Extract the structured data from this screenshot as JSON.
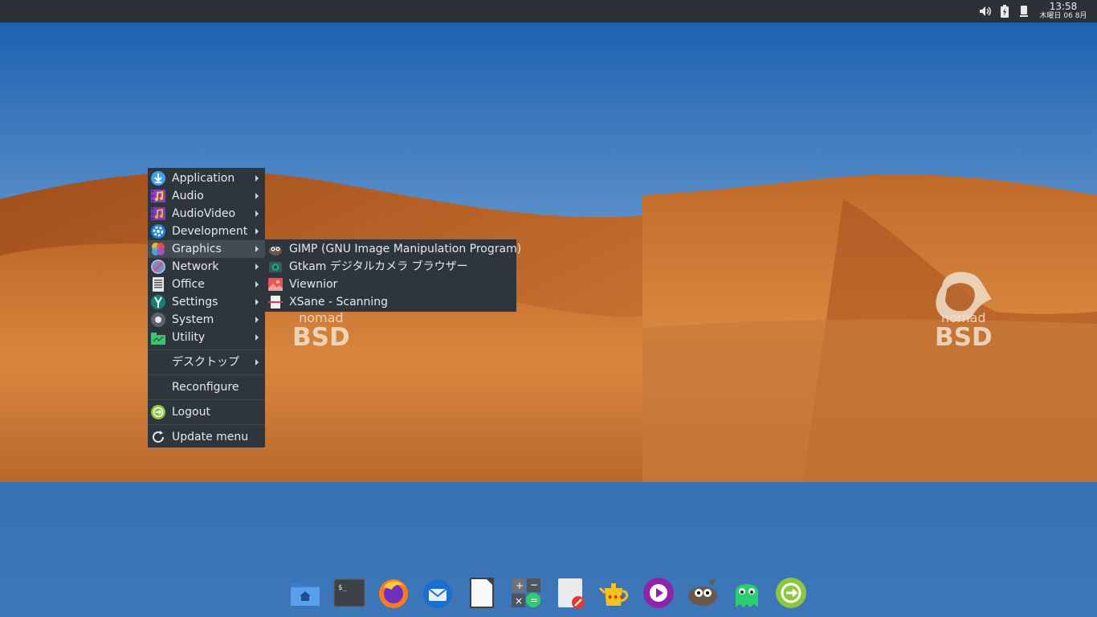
{
  "panel": {
    "clock_time": "13:58",
    "clock_date": "木曜日 06 8月",
    "tray_icons": [
      "volume-icon",
      "battery-icon",
      "removable-drive-icon"
    ]
  },
  "wallpaper": {
    "logo_line1": "nomad",
    "logo_line2": "BSD"
  },
  "menu": {
    "items": [
      {
        "label": "Application",
        "icon": "download-icon",
        "submenu": true
      },
      {
        "label": "Audio",
        "icon": "audio-icon",
        "submenu": true
      },
      {
        "label": "AudioVideo",
        "icon": "audiovideo-icon",
        "submenu": true
      },
      {
        "label": "Development",
        "icon": "gear-icon",
        "submenu": true
      },
      {
        "label": "Graphics",
        "icon": "graphics-icon",
        "submenu": true
      },
      {
        "label": "Network",
        "icon": "globe-icon",
        "submenu": true
      },
      {
        "label": "Office",
        "icon": "document-icon",
        "submenu": true
      },
      {
        "label": "Settings",
        "icon": "settings-icon",
        "submenu": true
      },
      {
        "label": "System",
        "icon": "system-icon",
        "submenu": true
      },
      {
        "label": "Utility",
        "icon": "utility-icon",
        "submenu": true
      }
    ],
    "desktop_label": "デスクトップ",
    "reconfigure_label": "Reconfigure",
    "logout_label": "Logout",
    "update_label": "Update menu"
  },
  "graphics_submenu": {
    "items": [
      {
        "label": "GIMP (GNU Image Manipulation Program)",
        "icon": "gimp-icon"
      },
      {
        "label": "Gtkam デジタルカメラ ブラウザー",
        "icon": "camera-icon"
      },
      {
        "label": "Viewnior",
        "icon": "image-viewer-icon"
      },
      {
        "label": "XSane - Scanning",
        "icon": "scanner-icon"
      }
    ]
  },
  "dock": {
    "items": [
      "home-folder-icon",
      "terminal-icon",
      "firefox-icon",
      "thunderbird-icon",
      "text-document-icon",
      "calculator-icon",
      "text-editor-icon",
      "teapot-icon",
      "media-player-icon",
      "gimp-icon",
      "ghost-icon",
      "logout-icon"
    ]
  },
  "colors": {
    "panel": "#2b3137",
    "menu_bg": "#2e353c",
    "menu_active": "#434b53",
    "sky_top": "#1f63b0",
    "sand": "#c8702c"
  }
}
